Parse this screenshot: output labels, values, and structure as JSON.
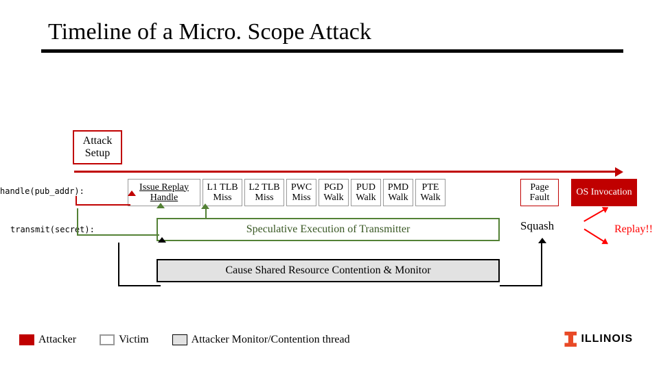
{
  "title": "Timeline of a Micro. Scope Attack",
  "attack_setup": "Attack Setup",
  "labels": {
    "handle": "handle(pub_addr):",
    "transmit": "transmit(secret):"
  },
  "row1": {
    "issue": "Issue Replay Handle",
    "l1": "L1 TLB Miss",
    "l2": "L2 TLB Miss",
    "pwc": "PWC Miss",
    "pgd": "PGD Walk",
    "pud": "PUD Walk",
    "pmd": "PMD Walk",
    "pte": "PTE Walk"
  },
  "page_fault": "Page Fault",
  "os_inv": "OS Invocation",
  "spec_exec": "Speculative Execution of Transmitter",
  "squash": "Squash",
  "replay": "Replay!!",
  "contend": "Cause Shared Resource Contention & Monitor",
  "legend": {
    "attacker": "Attacker",
    "victim": "Victim",
    "monitor": "Attacker Monitor/Contention thread"
  },
  "brand": "ILLINOIS"
}
